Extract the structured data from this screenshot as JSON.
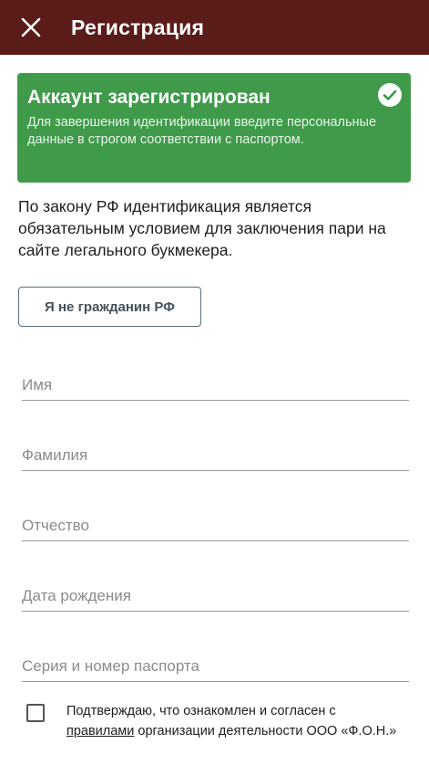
{
  "header": {
    "title": "Регистрация",
    "close_icon": "close-icon",
    "background": "#5a1c19"
  },
  "banner": {
    "title": "Аккаунт зарегистрирован",
    "text": "Для завершения идентификации введите персональные данные в строгом соответствии с паспортом.",
    "icon": "check-circle-icon",
    "background": "#3f9a4a"
  },
  "intro": {
    "text": "По закону РФ идентификация является обязательным условием для заключения пари на сайте легального букмекера."
  },
  "noncitizen_button": {
    "label": "Я не гражданин РФ"
  },
  "form": {
    "first_name": {
      "placeholder": "Имя",
      "value": ""
    },
    "last_name": {
      "placeholder": "Фамилия",
      "value": ""
    },
    "patronymic": {
      "placeholder": "Отчество",
      "value": ""
    },
    "birth_date": {
      "placeholder": "Дата рождения",
      "value": ""
    },
    "passport": {
      "placeholder": "Серия и номер паспорта",
      "value": ""
    }
  },
  "consent": {
    "checked": false,
    "text_before": "Подтверждаю, что ознакомлен и согласен с ",
    "link_text": "правилами",
    "text_after": " организации деятельности ООО «Ф.О.Н.»"
  }
}
